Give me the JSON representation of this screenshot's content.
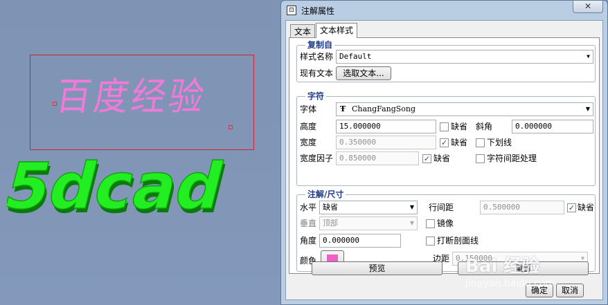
{
  "canvas": {
    "annotation_text": "百度经验",
    "logo_text": "5dcad",
    "colors": {
      "background": "#8296b7",
      "annotation": "#f07ad8",
      "logo": "#22ee22"
    }
  },
  "dialog": {
    "title": "注解属性",
    "close_label": "✕",
    "tabs": [
      "文本",
      "文本样式"
    ],
    "copy_from": {
      "title": "复制自",
      "style_name_label": "样式名称",
      "style_name_value": "Default",
      "existing_text_label": "现有文本",
      "select_text_button": "选取文本..."
    },
    "character": {
      "title": "字符",
      "font_label": "字体",
      "font_value": "ChangFangSong",
      "height_label": "高度",
      "height_value": "15.000000",
      "height_default_label": "缺省",
      "height_default_checked": false,
      "slant_label": "斜角",
      "slant_value": "0.000000",
      "thickness_label": "宽度",
      "thickness_value": "0.350000",
      "thickness_default_label": "缺省",
      "thickness_default_checked": true,
      "underline_label": "下划线",
      "underline_checked": false,
      "width_factor_label": "宽度因子",
      "width_factor_value": "0.850000",
      "width_factor_default_label": "缺省",
      "width_factor_default_checked": true,
      "kerning_label": "字符间距处理",
      "kerning_checked": false
    },
    "note_dimension": {
      "title": "注解/尺寸",
      "horizontal_label": "水平",
      "horizontal_value": "缺省",
      "line_spacing_label": "行间距",
      "line_spacing_value": "0.500000",
      "line_spacing_default_label": "缺省",
      "line_spacing_default_checked": true,
      "vertical_label": "垂直",
      "vertical_value": "顶部",
      "mirror_label": "镜像",
      "mirror_checked": false,
      "angle_label": "角度",
      "angle_value": "0.000000",
      "break_hatch_label": "打断剖面线",
      "break_hatch_checked": false,
      "color_label": "颜色",
      "color_value": "#f05ec8",
      "margin_label": "边距",
      "margin_value": "0.150000"
    },
    "preview_button": "预览",
    "reset_button": "重置",
    "ok_button": "确定",
    "cancel_button": "取消"
  },
  "watermark": {
    "text": "Bai 经验",
    "sub": "jingyan.baidu.com"
  }
}
